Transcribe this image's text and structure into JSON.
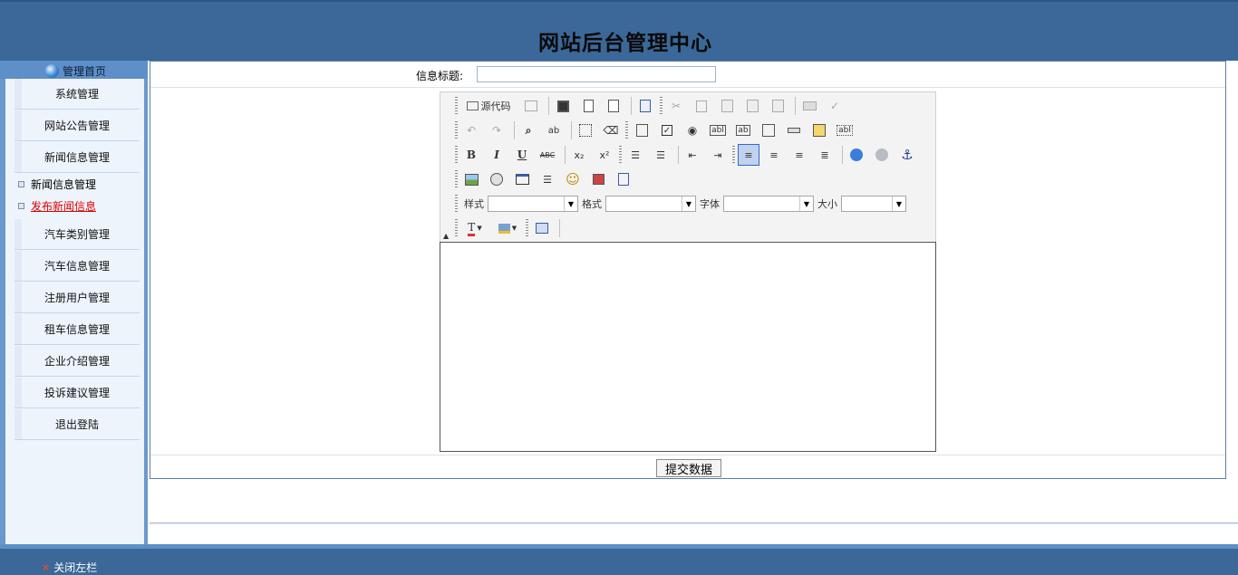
{
  "header": {
    "title": "网站后台管理中心"
  },
  "sidebar": {
    "home_label": "管理首页",
    "items": [
      {
        "label": "系统管理"
      },
      {
        "label": "网站公告管理"
      },
      {
        "label": "新闻信息管理"
      }
    ],
    "sub_items": [
      {
        "label": "新闻信息管理",
        "color": "#000000"
      },
      {
        "label": "发布新闻信息",
        "color": "#e00000"
      }
    ],
    "items_after": [
      {
        "label": "汽车类别管理"
      },
      {
        "label": "汽车信息管理"
      },
      {
        "label": "注册用户管理"
      },
      {
        "label": "租车信息管理"
      },
      {
        "label": "企业介绍管理"
      },
      {
        "label": "投诉建议管理"
      },
      {
        "label": "退出登陆"
      }
    ]
  },
  "form": {
    "title_label": "信息标题:",
    "title_value": "",
    "submit_label": "提交数据"
  },
  "editor": {
    "source_label": "源代码",
    "style_label": "样式",
    "format_label": "格式",
    "font_label": "字体",
    "size_label": "大小",
    "style_value": "",
    "format_value": "",
    "font_value": "",
    "size_value": ""
  },
  "footer": {
    "close_left_label": "关闭左栏"
  },
  "colors": {
    "header_bg": "#3b6898",
    "sidebar_bg": "#edf4fc",
    "active_sub": "#e00000"
  }
}
